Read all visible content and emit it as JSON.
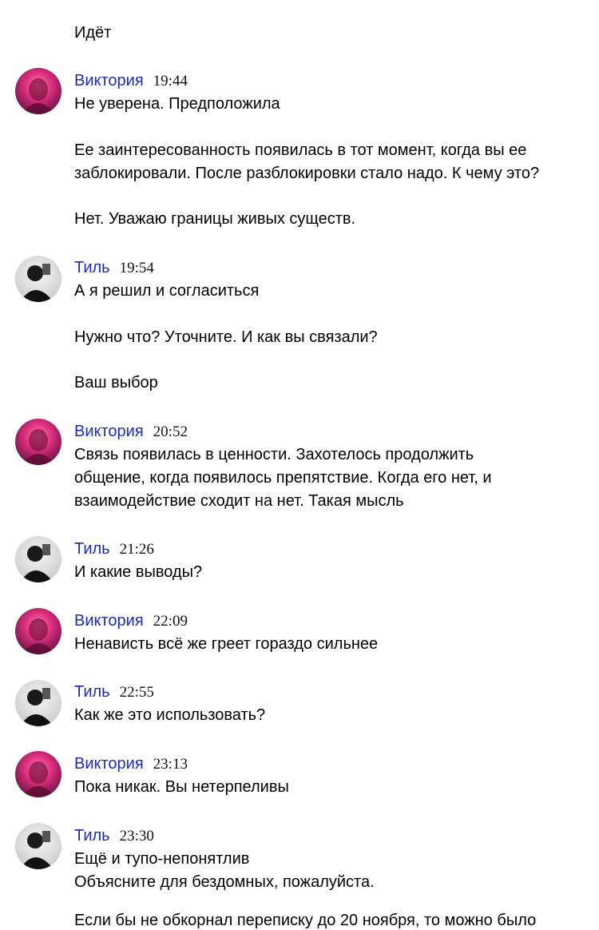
{
  "chat": {
    "top_line": "Идёт",
    "messages": [
      {
        "author": "Виктория",
        "time": "19:44",
        "lines": [
          "Не уверена. Предположила",
          "",
          "Ее заинтересованность появилась в тот момент, когда вы ее",
          "заблокировали. После разблокировки стало надо. К чему это?",
          "",
          "Нет. Уважаю границы живых существ."
        ]
      },
      {
        "author": "Тиль",
        "time": "19:54",
        "lines": [
          "А я решил и согласиться",
          "",
          "Нужно что? Уточните. И как вы связали?",
          "",
          "Ваш выбор"
        ]
      },
      {
        "author": "Виктория",
        "time": "20:52",
        "lines": [
          "Связь появилась в ценности. Захотелось продолжить",
          "общение, когда появилось препятствие. Когда его нет, и",
          "взаимодействие сходит на нет. Такая мысль"
        ]
      },
      {
        "author": "Тиль",
        "time": "21:26",
        "lines": [
          "И какие выводы?"
        ]
      },
      {
        "author": "Виктория",
        "time": "22:09",
        "lines": [
          "Ненависть всё же греет гораздо сильнее"
        ]
      },
      {
        "author": "Тиль",
        "time": "22:55",
        "lines": [
          "Как же это использовать?"
        ]
      },
      {
        "author": "Виктория",
        "time": "23:13",
        "lines": [
          "Пока никак. Вы нетерпеливы"
        ]
      },
      {
        "author": "Тиль",
        "time": "23:30",
        "lines": [
          "Ещё и тупо-непонятлив",
          "Объясните для бездомных, пожалуйста.",
          "",
          "Если бы не обкорнал переписку до 20 ноября, то можно было"
        ]
      }
    ]
  }
}
